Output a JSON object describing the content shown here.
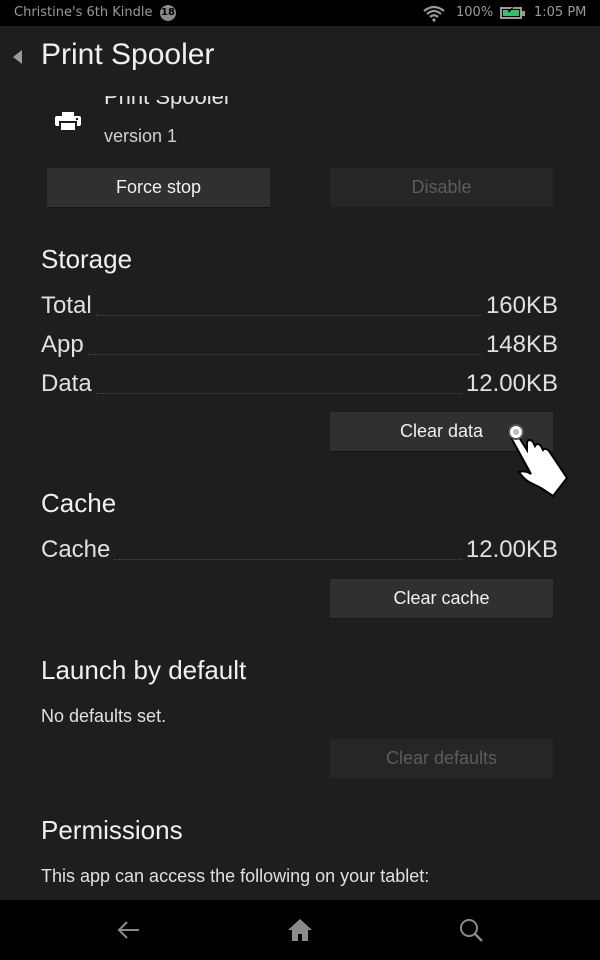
{
  "status_bar": {
    "device_name": "Christine's 6th Kindle",
    "notification_count": "18",
    "wifi_icon": "wifi-icon",
    "battery_percent": "100%",
    "battery_icon": "battery-charging-icon",
    "time": "1:05 PM",
    "battery_color": "#2fc269"
  },
  "app_bar": {
    "back_icon": "back-triangle-icon",
    "title": "Print Spooler"
  },
  "app_info": {
    "icon": "printer-icon",
    "name": "Print Spooler",
    "version": "version 1"
  },
  "actions": {
    "force_stop": "Force stop",
    "disable": "Disable"
  },
  "storage": {
    "title": "Storage",
    "rows": [
      {
        "label": "Total",
        "value": "160KB"
      },
      {
        "label": "App",
        "value": "148KB"
      },
      {
        "label": "Data",
        "value": "12.00KB"
      }
    ],
    "clear_data": "Clear data"
  },
  "cache": {
    "title": "Cache",
    "rows": [
      {
        "label": "Cache",
        "value": "12.00KB"
      }
    ],
    "clear_cache": "Clear cache"
  },
  "launch_default": {
    "title": "Launch by default",
    "text": "No defaults set.",
    "clear_defaults": "Clear defaults"
  },
  "permissions": {
    "title": "Permissions",
    "text": "This app can access the following on your tablet:"
  },
  "nav_bar": {
    "back": "back-arrow-icon",
    "home": "home-icon",
    "search": "search-icon"
  }
}
